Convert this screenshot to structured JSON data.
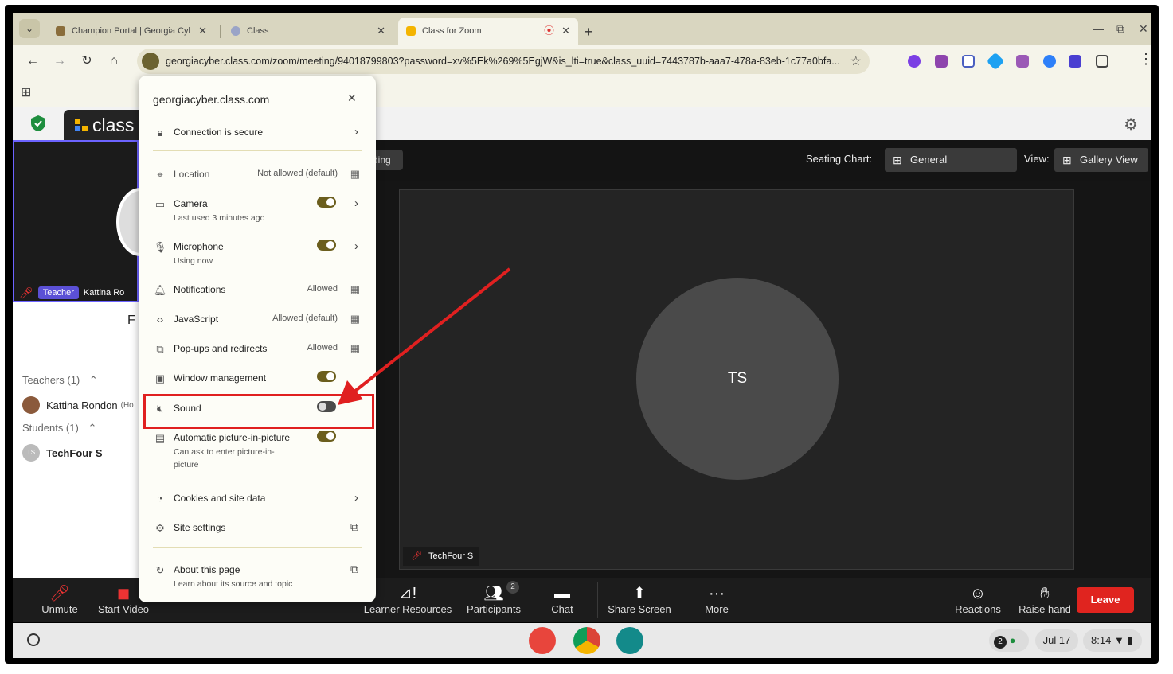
{
  "browser": {
    "tabs": [
      {
        "title": "Champion Portal | Georgia Cyb"
      },
      {
        "title": "Class"
      },
      {
        "title": "Class for Zoom"
      }
    ],
    "url": "georgiacyber.class.com/zoom/meeting/94018799803?password=xv%5Ek%269%5EgjW&is_lti=true&class_uuid=7443787b-aaa7-478a-83eb-1c77a0bfa..."
  },
  "app": {
    "logo_text": "class",
    "recording_chip": "ding",
    "seating_label": "Seating Chart:",
    "seating_value": "General",
    "view_label": "View:",
    "view_value": "Gallery View"
  },
  "sidebar": {
    "teacher_badge": "Teacher",
    "teacher_tile_name": "Kattina Ro",
    "stray": "F",
    "teachers_header": "Teachers (1)",
    "teacher_name": "Kattina Rondon",
    "teacher_suffix": "(Ho",
    "students_header": "Students (1)",
    "student_name": "TechFour S",
    "student_initials": "TS"
  },
  "stage": {
    "initials": "TS",
    "name": "TechFour S"
  },
  "zoom_bar": {
    "unmute": "Unmute",
    "start_video": "Start Video",
    "learner_resources": "Learner Resources",
    "participants": "Participants",
    "participants_count": "2",
    "chat": "Chat",
    "share_screen": "Share Screen",
    "more": "More",
    "reactions": "Reactions",
    "raise_hand": "Raise hand",
    "leave": "Leave"
  },
  "shelf": {
    "notif_count": "2",
    "date": "Jul 17",
    "time": "8:14"
  },
  "popup": {
    "host": "georgiacyber.class.com",
    "connection": "Connection is secure",
    "location": "Location",
    "location_value": "Not allowed (default)",
    "camera": "Camera",
    "camera_sub": "Last used 3 minutes ago",
    "microphone": "Microphone",
    "microphone_sub": "Using now",
    "notifications": "Notifications",
    "notifications_value": "Allowed",
    "javascript": "JavaScript",
    "javascript_value": "Allowed (default)",
    "popups": "Pop-ups and redirects",
    "popups_value": "Allowed",
    "window_management": "Window management",
    "sound": "Sound",
    "pip": "Automatic picture-in-picture",
    "pip_sub": "Can ask to enter picture-in-picture",
    "cookies": "Cookies and site data",
    "site_settings": "Site settings",
    "about": "About this page",
    "about_sub": "Learn about its source and topic"
  },
  "colors": {
    "toggle_on": "#6b5e1d",
    "annotation_red": "#e02020",
    "leave_red": "#e0241f"
  }
}
